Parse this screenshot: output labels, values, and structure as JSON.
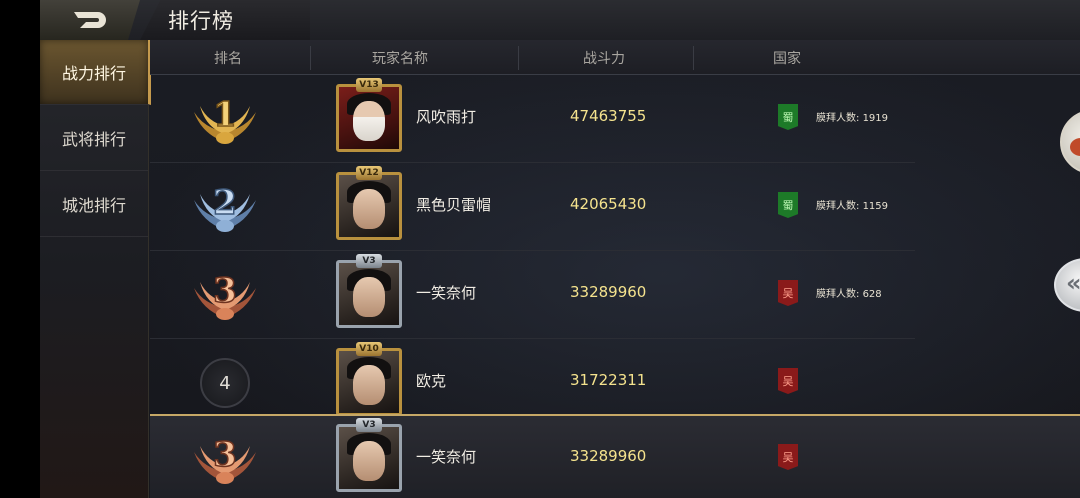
{
  "header": {
    "title": "排行榜",
    "back_icon": "back-arrow-icon"
  },
  "sidebar": {
    "items": [
      {
        "label": "战力排行",
        "active": true
      },
      {
        "label": "武将排行",
        "active": false
      },
      {
        "label": "城池排行",
        "active": false
      }
    ]
  },
  "table": {
    "columns": [
      "排名",
      "玩家名称",
      "战斗力",
      "国家"
    ],
    "rows": [
      {
        "rank": "1",
        "vip": "V13",
        "name": "风吹雨打",
        "power": "47463755",
        "country": "蜀",
        "worship_label": "膜拜人数:",
        "worship_count": "1919"
      },
      {
        "rank": "2",
        "vip": "V12",
        "name": "黑色贝雷帽",
        "power": "42065430",
        "country": "蜀",
        "worship_label": "膜拜人数:",
        "worship_count": "1159"
      },
      {
        "rank": "3",
        "vip": "V3",
        "name": "一笑奈何",
        "power": "33289960",
        "country": "吴",
        "worship_label": "膜拜人数:",
        "worship_count": "628"
      },
      {
        "rank": "4",
        "vip": "V10",
        "name": "欧克",
        "power": "31722311",
        "country": "吴"
      }
    ],
    "self_row": {
      "rank": "3",
      "vip": "V3",
      "name": "一笑奈何",
      "power": "33289960",
      "country": "吴"
    }
  },
  "colors": {
    "gold_medal": "#d9a63e",
    "silver_medal": "#8fb0d6",
    "bronze_medal": "#d9835a",
    "power_text": "#f5e38e",
    "shu_flag": "#1d7a28",
    "wu_flag": "#8a1a1a"
  }
}
